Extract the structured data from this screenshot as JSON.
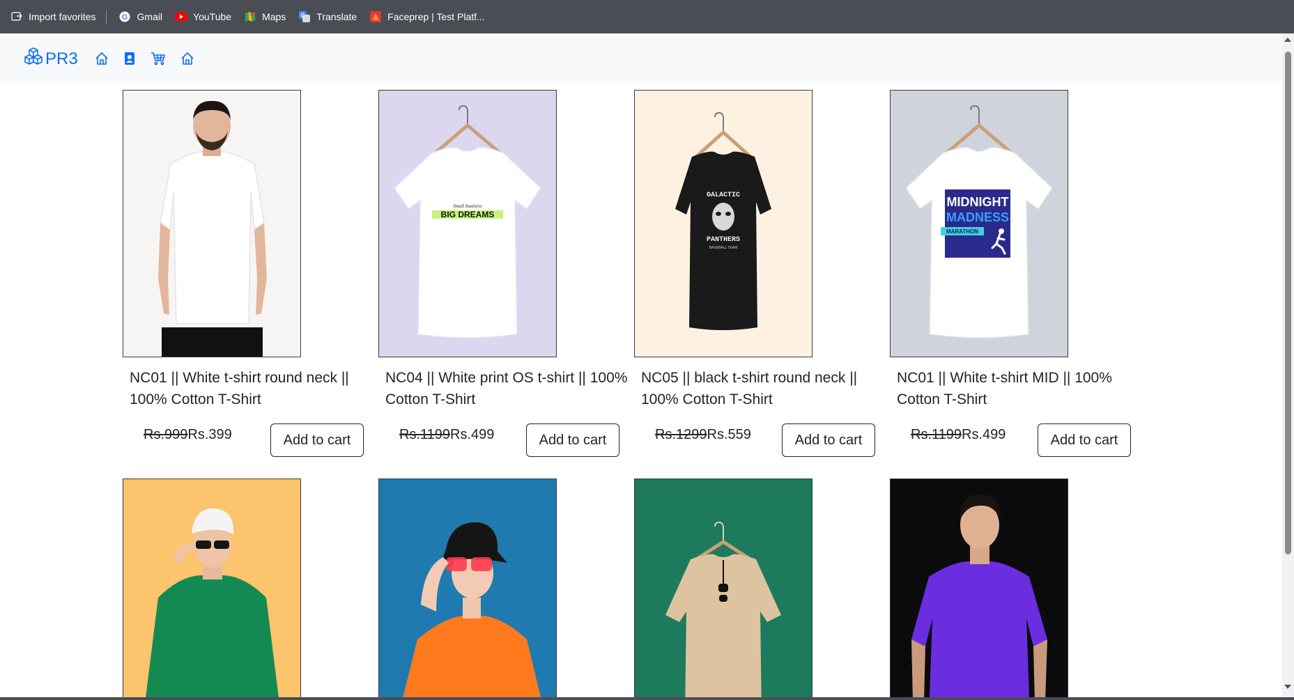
{
  "bookmarks": [
    {
      "label": "Import favorites",
      "icon": "import-icon"
    },
    {
      "label": "Gmail",
      "icon": "google-icon"
    },
    {
      "label": "YouTube",
      "icon": "youtube-icon"
    },
    {
      "label": "Maps",
      "icon": "maps-icon"
    },
    {
      "label": "Translate",
      "icon": "translate-icon"
    },
    {
      "label": "Faceprep | Test Platf...",
      "icon": "faceprep-icon"
    }
  ],
  "navbar": {
    "brand": "PR3",
    "brand_icon": "boxes-icon",
    "icons": [
      "home-icon",
      "contact-card-icon",
      "cart-icon",
      "home-icon"
    ],
    "accent_color": "#0d6efd"
  },
  "products": [
    {
      "title": "NC01 || White t-shirt round neck || 100% Cotton T-Shirt",
      "old_price": "Rs.999",
      "price": "Rs.399",
      "button": "Add to cart",
      "bg": "#f4f4f4",
      "image": "man in white t-shirt"
    },
    {
      "title": "NC04 || White print OS t-shirt || 100% Cotton T-Shirt",
      "old_price": "Rs.1199",
      "price": "Rs.499",
      "button": "Add to cart",
      "bg": "#dcd6ee",
      "image": "white t-shirt on hanger"
    },
    {
      "title": "NC05 || black t-shirt round neck || 100% Cotton T-Shirt",
      "old_price": "Rs.1299",
      "price": "Rs.559",
      "button": "Add to cart",
      "bg": "#fdf2e2",
      "image": "black t-shirt on hanger"
    },
    {
      "title": "NC01 || White t-shirt MID || 100% Cotton T-Shirt",
      "old_price": "Rs.1199",
      "price": "Rs.499",
      "button": "Add to cart",
      "bg": "#cfd3dc",
      "image": "white t-shirt on hanger"
    },
    {
      "bg": "#fcc46d",
      "image": "man in green shirt with cap"
    },
    {
      "bg": "#1f7ab0",
      "image": "person in orange t-shirt with bucket hat"
    },
    {
      "bg": "#1e7a5c",
      "image": "beige t-shirt on hanger"
    },
    {
      "bg": "#0b0b0d",
      "image": "man in purple t-shirt"
    }
  ],
  "print_texts": {
    "card2": [
      "Small business",
      "BIG DREAMS"
    ],
    "card3": [
      "GALACTIC",
      "PANTHERS",
      "BASEBALL TEAM"
    ],
    "card4": [
      "MIDNIGHT",
      "MADNESS",
      "MARATHON"
    ]
  }
}
